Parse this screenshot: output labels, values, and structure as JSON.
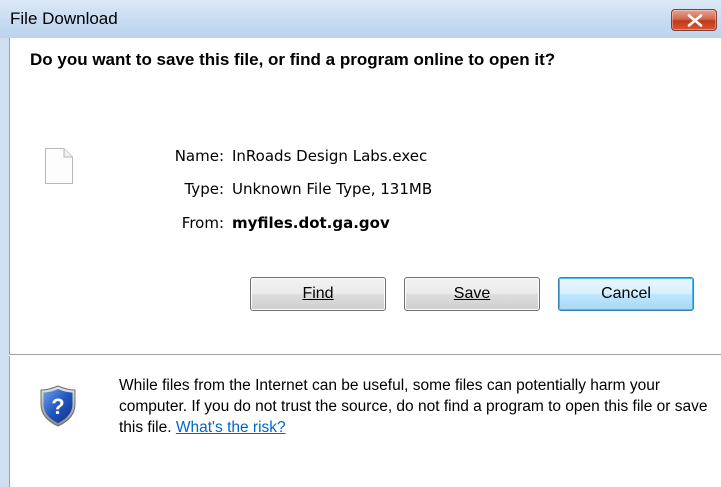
{
  "window": {
    "title": "File Download",
    "close_icon": "close-icon"
  },
  "dialog": {
    "question": "Do you want to save this file, or find a program online to open it?",
    "file_icon": "blank-file-icon",
    "name_label": "Name:",
    "name_value": "InRoads Design Labs.exec",
    "type_label": "Type:",
    "type_value": "Unknown File Type, 131MB",
    "from_label": "From:",
    "from_value": "myfiles.dot.ga.gov"
  },
  "buttons": {
    "find_label": "Find",
    "save_label": "Save",
    "cancel_label": "Cancel"
  },
  "footer": {
    "shield_icon": "security-shield-icon",
    "warning_text": "While files from the Internet can be useful, some files can potentially harm your computer. If you do not trust the source, do not find a program to open this file or save this file.",
    "risk_link": "What's the risk?"
  },
  "colors": {
    "titlebar": "#c9dcf1",
    "close_button": "#c3391a",
    "link": "#0066cc",
    "default_button_border": "#3c7fb1"
  }
}
